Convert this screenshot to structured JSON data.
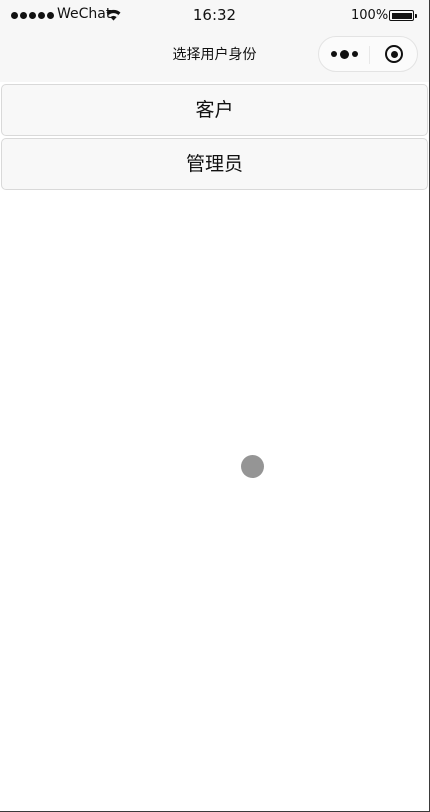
{
  "status_bar": {
    "carrier": "WeChat",
    "time": "16:32",
    "battery_percent": "100%",
    "battery_level": 1.0,
    "icons": [
      "signal-dots-icon",
      "wifi-icon",
      "battery-icon"
    ]
  },
  "nav_bar": {
    "title": "选择用户身份",
    "capsule": {
      "more_icon": "more-dots-icon",
      "close_icon": "close-circle-icon"
    }
  },
  "roles": [
    {
      "label": "客户"
    },
    {
      "label": "管理员"
    }
  ],
  "colors": {
    "page_background": "#ffffff",
    "bar_background": "#f7f7f7",
    "button_background": "#f8f8f8",
    "button_border": "#d9d9d9",
    "touch_indicator": "#8a8a8a"
  }
}
